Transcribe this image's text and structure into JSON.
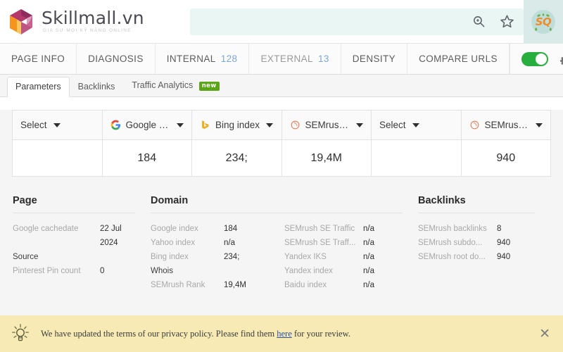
{
  "browser": {
    "logo": {
      "title": "Skillmall.vn",
      "tagline": "GIA SƯ MỌI KỸ NĂNG ONLINE",
      "mark_colors": [
        "#f5a623",
        "#f7941e",
        "#8e2d5c",
        "#b4386b",
        "#c96090",
        "#d9a0bd"
      ]
    },
    "omnibox_value": "",
    "omnibox_placeholder": "",
    "zoom_icon": "search-zoom-icon",
    "bookmark_icon": "star-icon",
    "extension_badge": "SQ",
    "extension_colors": {
      "text": "#f08b2c",
      "leaf": "#6ab04c",
      "bg": "#bfded9"
    }
  },
  "main_tabs": [
    {
      "label": "PAGE INFO",
      "count": ""
    },
    {
      "label": "DIAGNOSIS",
      "count": ""
    },
    {
      "label": "INTERNAL",
      "count": "128"
    },
    {
      "label": "EXTERNAL",
      "count": "13"
    },
    {
      "label": "DENSITY",
      "count": ""
    },
    {
      "label": "COMPARE URLS",
      "count": ""
    }
  ],
  "tab_controls": {
    "toggle_state": "on",
    "toggle_color": "#27ae3f",
    "settings_icon": "gear-icon",
    "settings_has_alert": "true",
    "alert_color": "#e8372a"
  },
  "sub_tabs": [
    {
      "label": "Parameters",
      "badge": "",
      "active": "true"
    },
    {
      "label": "Backlinks",
      "badge": "",
      "active": "false"
    },
    {
      "label": "Traffic Analytics",
      "badge": "new",
      "active": "false"
    }
  ],
  "params_table": {
    "columns": [
      {
        "label": "Select",
        "icon": "",
        "value": ""
      },
      {
        "label": "Google index",
        "icon": "google-icon",
        "value": "184"
      },
      {
        "label": "Bing index",
        "icon": "bing-icon",
        "value": "234;"
      },
      {
        "label": "SEMrush ...",
        "icon": "semrush-icon",
        "value": "19,4M"
      },
      {
        "label": "Select",
        "icon": "",
        "value": ""
      },
      {
        "label": "SEMrush s...",
        "icon": "semrush-icon",
        "value": "940"
      }
    ]
  },
  "page_section": {
    "title": "Page",
    "rows": [
      {
        "key": "Google cachedate",
        "value": "22 Jul 2024",
        "key_dark": false
      },
      {
        "key": "Source",
        "value": "",
        "key_dark": true
      },
      {
        "key": "Pinterest Pin count",
        "value": "0",
        "key_dark": false
      }
    ]
  },
  "domain_section": {
    "title": "Domain",
    "rows_left": [
      {
        "key": "Google index",
        "value": "184",
        "key_dark": false
      },
      {
        "key": "Yahoo index",
        "value": "n/a",
        "key_dark": false
      },
      {
        "key": "Bing index",
        "value": "234;",
        "key_dark": false
      },
      {
        "key": "Whois",
        "value": "",
        "key_dark": true
      },
      {
        "key": "SEMrush Rank",
        "value": "19,4M",
        "key_dark": false
      }
    ],
    "rows_right": [
      {
        "key": "SEMrush SE Traffic",
        "value": "n/a",
        "key_dark": false
      },
      {
        "key": "SEMrush SE Traff...",
        "value": "n/a",
        "key_dark": false
      },
      {
        "key": "Yandex IKS",
        "value": "n/a",
        "key_dark": false
      },
      {
        "key": "Yandex index",
        "value": "n/a",
        "key_dark": false
      },
      {
        "key": "Baidu index",
        "value": "n/a",
        "key_dark": false
      }
    ]
  },
  "backlinks_section": {
    "title": "Backlinks",
    "rows": [
      {
        "key": "SEMrush backlinks",
        "value": "8",
        "key_dark": false
      },
      {
        "key": "SEMrush subdo...",
        "value": "940",
        "key_dark": false
      },
      {
        "key": "SEMrush root do...",
        "value": "940",
        "key_dark": false
      }
    ]
  },
  "notice": {
    "icon": "lightbulb-icon",
    "text_before": "We have updated the terms of our privacy policy. Please find them ",
    "link_text": "here",
    "text_after": " for your review.",
    "close_label": "✕",
    "background": "#f7eab4"
  }
}
